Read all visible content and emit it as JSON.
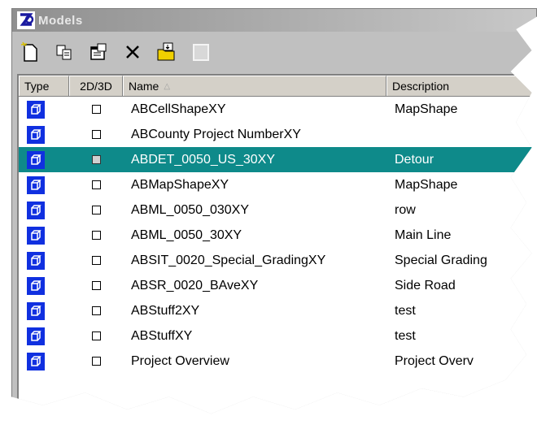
{
  "window": {
    "title": "Models"
  },
  "toolbar": {
    "buttons": [
      {
        "icon": "new-model-icon"
      },
      {
        "icon": "copy-icon"
      },
      {
        "icon": "properties-icon"
      },
      {
        "icon": "delete-icon"
      },
      {
        "icon": "import-icon"
      },
      {
        "icon": "blank-icon"
      }
    ]
  },
  "columns": {
    "type": "Type",
    "dim": "2D/3D",
    "name": "Name",
    "desc": "Description"
  },
  "rows": [
    {
      "name": "ABCellShapeXY",
      "desc": "MapShape"
    },
    {
      "name": "ABCounty Project NumberXY",
      "desc": ""
    },
    {
      "name": "ABDET_0050_US_30XY",
      "desc": "Detour",
      "selected": true
    },
    {
      "name": "ABMapShapeXY",
      "desc": "MapShape"
    },
    {
      "name": "ABML_0050_030XY",
      "desc": "row"
    },
    {
      "name": "ABML_0050_30XY",
      "desc": "Main Line"
    },
    {
      "name": "ABSIT_0020_Special_GradingXY",
      "desc": "Special Grading"
    },
    {
      "name": "ABSR_0020_BAveXY",
      "desc": "Side Road"
    },
    {
      "name": "ABStuff2XY",
      "desc": "test"
    },
    {
      "name": "ABStuffXY",
      "desc": "test"
    },
    {
      "name": "Project Overview",
      "desc": "Project Overv"
    }
  ],
  "colors": {
    "selection": "#0e8a8a",
    "type_icon": "#1030e0"
  }
}
